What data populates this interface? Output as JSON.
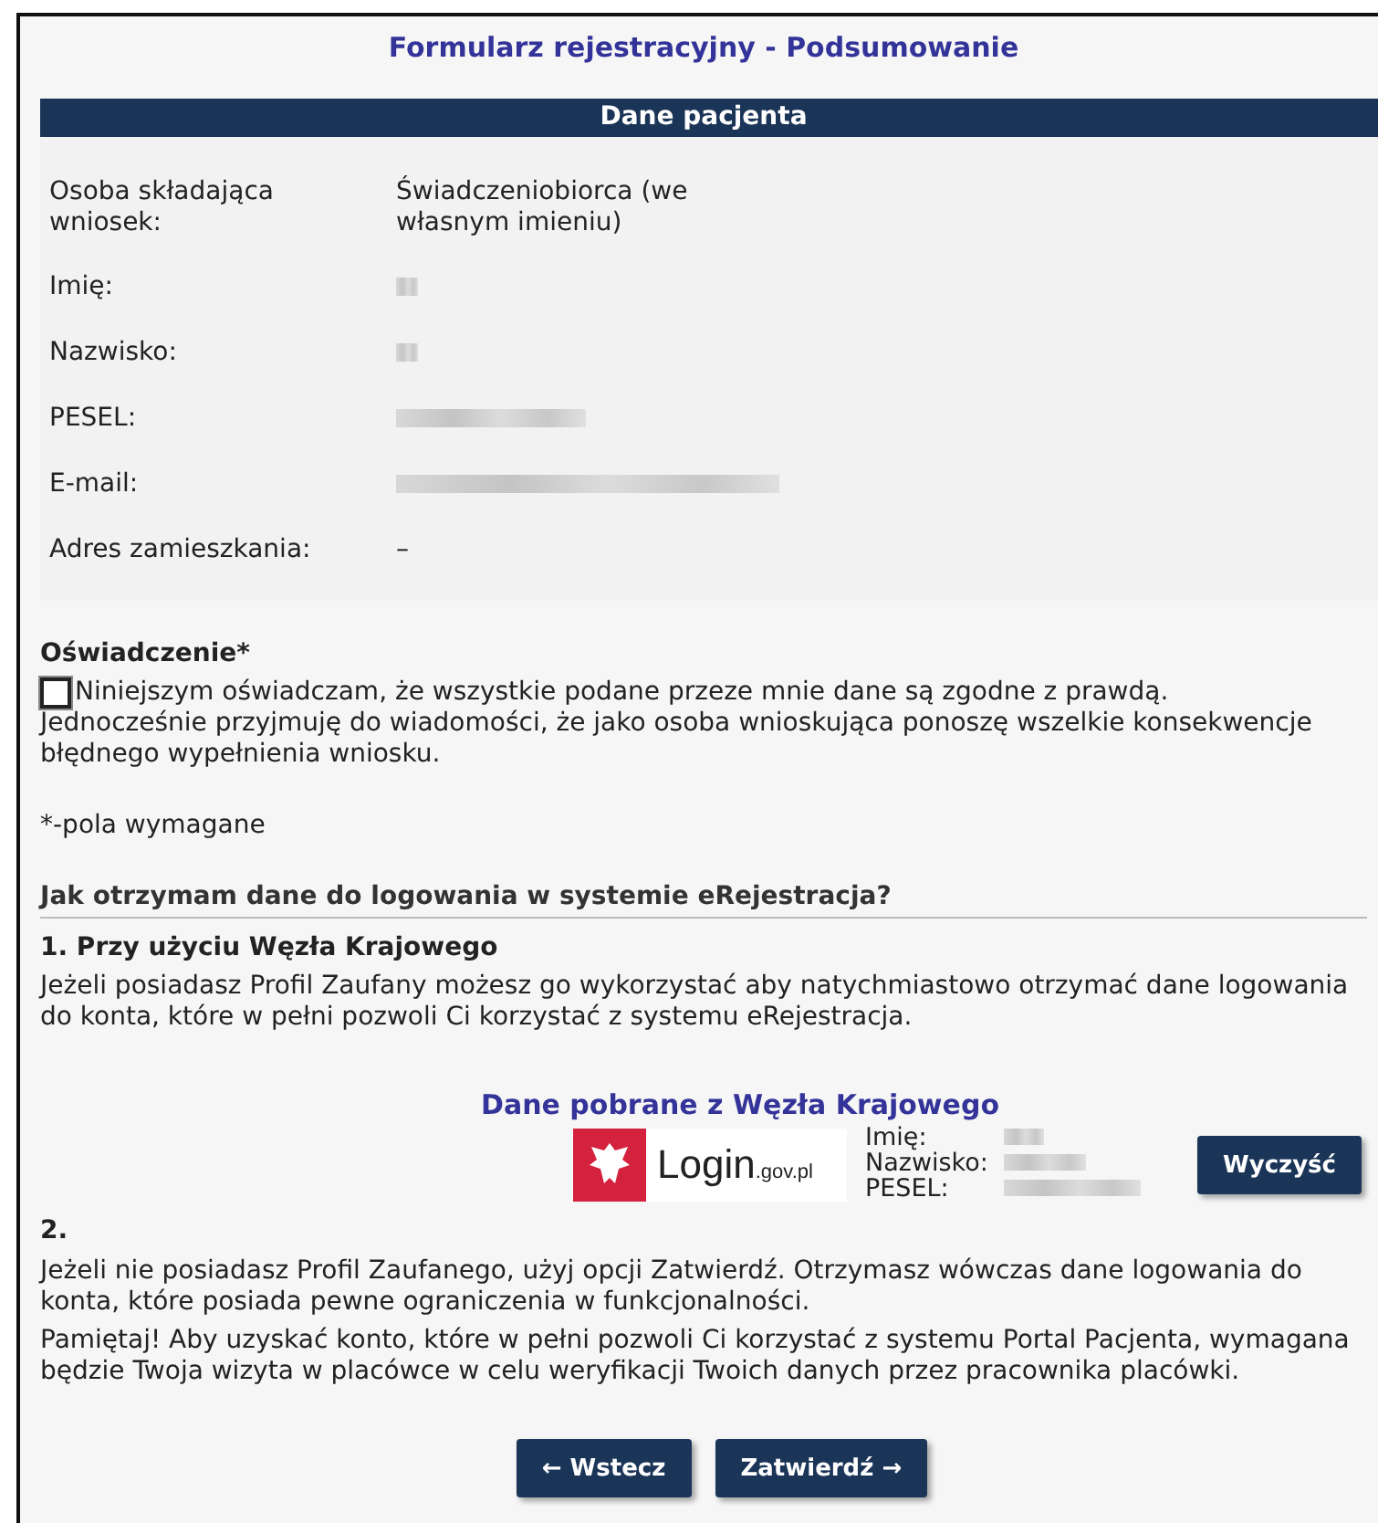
{
  "title": "Formularz rejestracyjny - Podsumowanie",
  "patient": {
    "header": "Dane pacjenta",
    "rows": [
      {
        "label": "Osoba składająca wniosek:",
        "kind": "text",
        "value": "Świadczeniobiorca (we własnym imieniu)"
      },
      {
        "label": "Imię:",
        "kind": "redacted"
      },
      {
        "label": "Nazwisko:",
        "kind": "redacted"
      },
      {
        "label": "PESEL:",
        "kind": "redacted"
      },
      {
        "label": "E-mail:",
        "kind": "redacted"
      },
      {
        "label": "Adres zamieszkania:",
        "kind": "text",
        "value": "–"
      }
    ]
  },
  "declaration": {
    "title": "Oświadczenie*",
    "checked": false,
    "line": "Niniejszym oświadczam, że wszystkie podane przeze mnie dane są zgodne z prawdą.",
    "text": "Jednocześnie przyjmuję do wiadomości, że jako osoba wnioskująca ponoszę wszelkie konsekwencje błędnego wypełnienia wniosku."
  },
  "required_note": "*-pola wymagane",
  "login_info": {
    "heading": "Jak otrzymam dane do logowania w systemie eRejestracja?",
    "option_1": {
      "title": "1. Przy użyciu Węzła Krajowego",
      "text": "Jeżeli posiadasz Profil Zaufany możesz go wykorzystać aby natychmiastowo otrzymać dane logowania do konta, które w pełni pozwoli Ci korzystać z systemu eRejestracja."
    },
    "node": {
      "title": "Dane pobrane z Węzła Krajowego",
      "logo_text": "Login",
      "logo_suffix": ".gov.pl",
      "fields": [
        {
          "label": "Imię:",
          "kind": "redacted"
        },
        {
          "label": "Nazwisko:",
          "kind": "redacted"
        },
        {
          "label": "PESEL:",
          "kind": "redacted"
        }
      ],
      "clear_button": "Wyczyść"
    },
    "option_2": {
      "title": "2.",
      "paragraphs": [
        "Jeżeli nie posiadasz Profil Zaufanego, użyj opcji Zatwierdź. Otrzymasz wówczas dane logowania do konta, które posiada pewne ograniczenia w funkcjonalności.",
        "Pamiętaj! Aby uzyskać konto, które w pełni pozwoli Ci korzystać z systemu Portal Pacjenta, wymagana będzie Twoja wizyta w placówce w celu weryfikacji Twoich danych przez pracownika placówki."
      ]
    }
  },
  "buttons": [
    {
      "label": "← Wstecz"
    },
    {
      "label": "Zatwierdź →"
    }
  ]
}
